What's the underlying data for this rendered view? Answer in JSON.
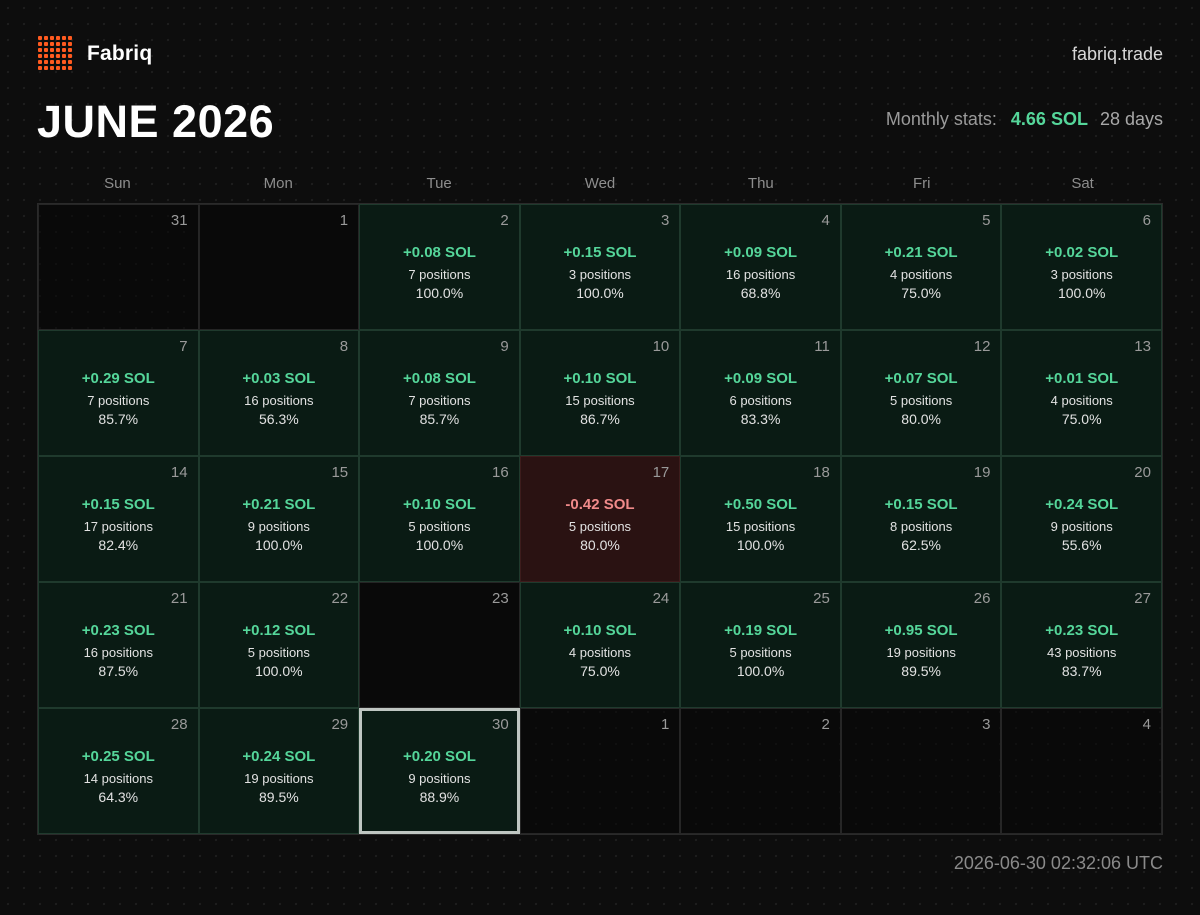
{
  "brand": {
    "name": "Fabriq",
    "logo_icon": "orange-dot-grid-logo",
    "accent": "#ff5a1f"
  },
  "site": "fabriq.trade",
  "title": "JUNE 2026",
  "stats": {
    "label": "Monthly stats:",
    "total": "4.66 SOL",
    "days": "28 days"
  },
  "weekdays": [
    "Sun",
    "Mon",
    "Tue",
    "Wed",
    "Thu",
    "Fri",
    "Sat"
  ],
  "colors": {
    "gain": "#55d69a",
    "loss": "#f08a8a",
    "background": "#0d0d0d"
  },
  "days": [
    {
      "day": "31",
      "state": "outside"
    },
    {
      "day": "1",
      "state": "empty"
    },
    {
      "day": "2",
      "state": "gain",
      "amount": "+0.08 SOL",
      "positions": "7 positions",
      "rate": "100.0%"
    },
    {
      "day": "3",
      "state": "gain",
      "amount": "+0.15 SOL",
      "positions": "3 positions",
      "rate": "100.0%"
    },
    {
      "day": "4",
      "state": "gain",
      "amount": "+0.09 SOL",
      "positions": "16 positions",
      "rate": "68.8%"
    },
    {
      "day": "5",
      "state": "gain",
      "amount": "+0.21 SOL",
      "positions": "4 positions",
      "rate": "75.0%"
    },
    {
      "day": "6",
      "state": "gain",
      "amount": "+0.02 SOL",
      "positions": "3 positions",
      "rate": "100.0%"
    },
    {
      "day": "7",
      "state": "gain",
      "amount": "+0.29 SOL",
      "positions": "7 positions",
      "rate": "85.7%"
    },
    {
      "day": "8",
      "state": "gain",
      "amount": "+0.03 SOL",
      "positions": "16 positions",
      "rate": "56.3%"
    },
    {
      "day": "9",
      "state": "gain",
      "amount": "+0.08 SOL",
      "positions": "7 positions",
      "rate": "85.7%"
    },
    {
      "day": "10",
      "state": "gain",
      "amount": "+0.10 SOL",
      "positions": "15 positions",
      "rate": "86.7%"
    },
    {
      "day": "11",
      "state": "gain",
      "amount": "+0.09 SOL",
      "positions": "6 positions",
      "rate": "83.3%"
    },
    {
      "day": "12",
      "state": "gain",
      "amount": "+0.07 SOL",
      "positions": "5 positions",
      "rate": "80.0%"
    },
    {
      "day": "13",
      "state": "gain",
      "amount": "+0.01 SOL",
      "positions": "4 positions",
      "rate": "75.0%"
    },
    {
      "day": "14",
      "state": "gain",
      "amount": "+0.15 SOL",
      "positions": "17 positions",
      "rate": "82.4%"
    },
    {
      "day": "15",
      "state": "gain",
      "amount": "+0.21 SOL",
      "positions": "9 positions",
      "rate": "100.0%"
    },
    {
      "day": "16",
      "state": "gain",
      "amount": "+0.10 SOL",
      "positions": "5 positions",
      "rate": "100.0%"
    },
    {
      "day": "17",
      "state": "loss",
      "amount": "-0.42 SOL",
      "positions": "5 positions",
      "rate": "80.0%"
    },
    {
      "day": "18",
      "state": "gain",
      "amount": "+0.50 SOL",
      "positions": "15 positions",
      "rate": "100.0%"
    },
    {
      "day": "19",
      "state": "gain",
      "amount": "+0.15 SOL",
      "positions": "8 positions",
      "rate": "62.5%"
    },
    {
      "day": "20",
      "state": "gain",
      "amount": "+0.24 SOL",
      "positions": "9 positions",
      "rate": "55.6%"
    },
    {
      "day": "21",
      "state": "gain",
      "amount": "+0.23 SOL",
      "positions": "16 positions",
      "rate": "87.5%"
    },
    {
      "day": "22",
      "state": "gain",
      "amount": "+0.12 SOL",
      "positions": "5 positions",
      "rate": "100.0%"
    },
    {
      "day": "23",
      "state": "empty"
    },
    {
      "day": "24",
      "state": "gain",
      "amount": "+0.10 SOL",
      "positions": "4 positions",
      "rate": "75.0%"
    },
    {
      "day": "25",
      "state": "gain",
      "amount": "+0.19 SOL",
      "positions": "5 positions",
      "rate": "100.0%"
    },
    {
      "day": "26",
      "state": "gain",
      "amount": "+0.95 SOL",
      "positions": "19 positions",
      "rate": "89.5%"
    },
    {
      "day": "27",
      "state": "gain",
      "amount": "+0.23 SOL",
      "positions": "43 positions",
      "rate": "83.7%"
    },
    {
      "day": "28",
      "state": "gain",
      "amount": "+0.25 SOL",
      "positions": "14 positions",
      "rate": "64.3%"
    },
    {
      "day": "29",
      "state": "gain",
      "amount": "+0.24 SOL",
      "positions": "19 positions",
      "rate": "89.5%"
    },
    {
      "day": "30",
      "state": "gain",
      "today": true,
      "amount": "+0.20 SOL",
      "positions": "9 positions",
      "rate": "88.9%"
    },
    {
      "day": "1",
      "state": "outside"
    },
    {
      "day": "2",
      "state": "outside"
    },
    {
      "day": "3",
      "state": "outside"
    },
    {
      "day": "4",
      "state": "outside"
    }
  ],
  "timestamp": "2026-06-30 02:32:06 UTC"
}
